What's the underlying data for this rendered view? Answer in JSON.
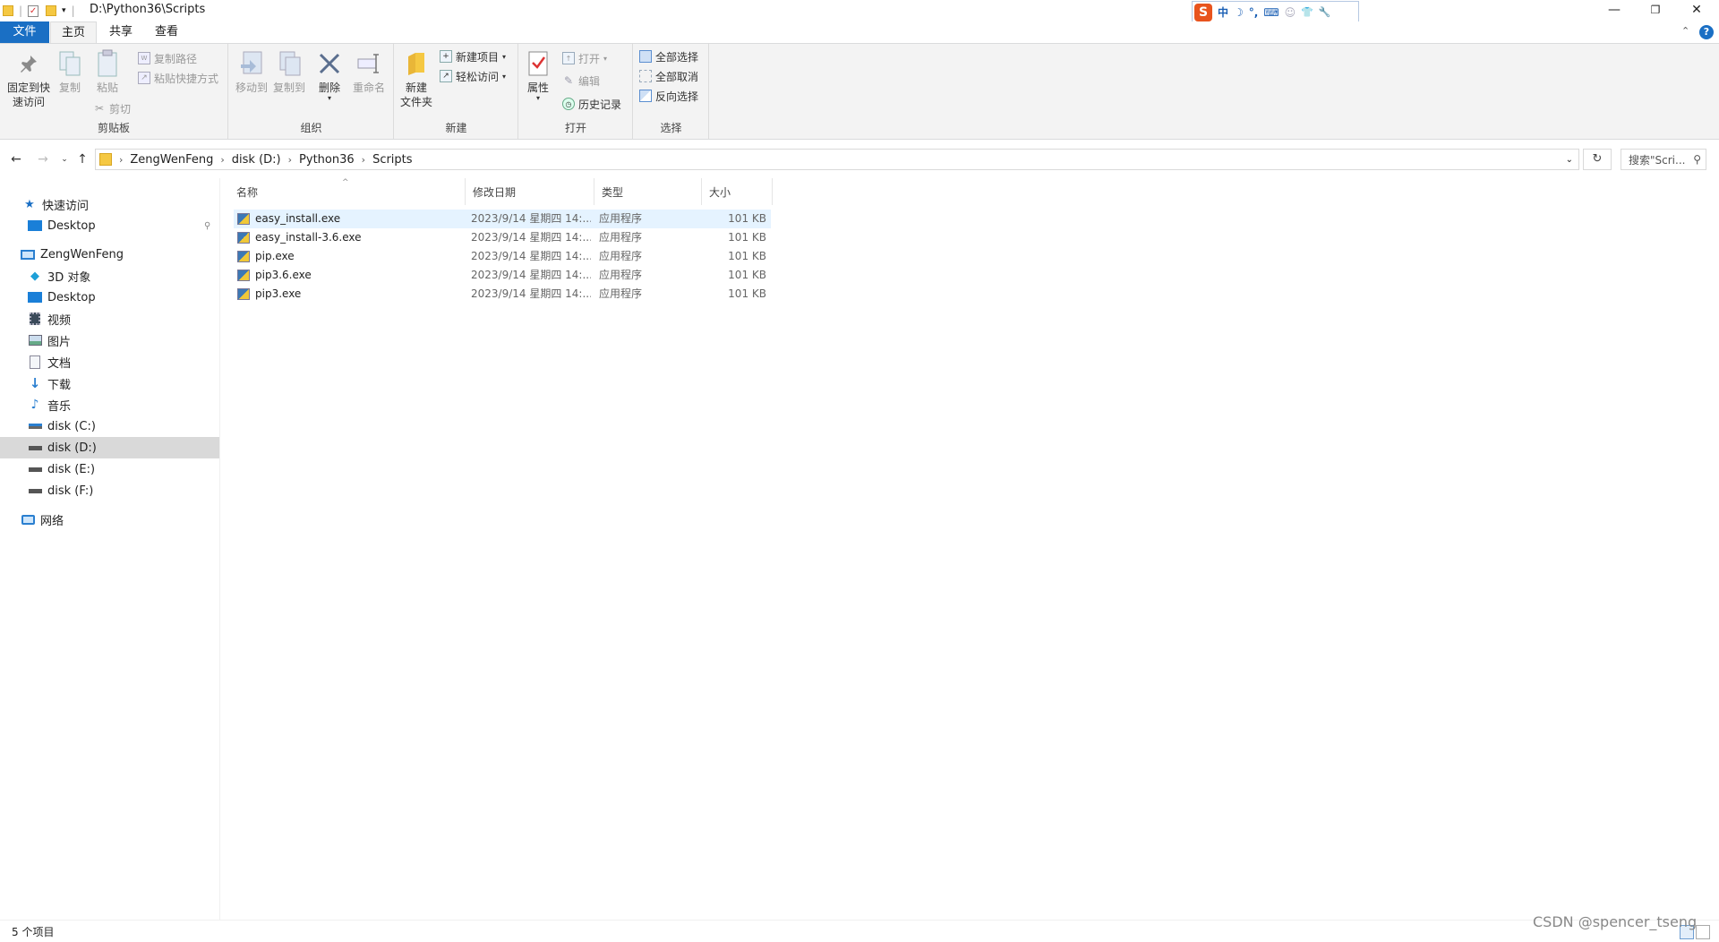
{
  "window": {
    "title": "D:\\Python36\\Scripts",
    "controls": {
      "minimize": "—",
      "restore": "❐",
      "close": "✕"
    }
  },
  "ime": {
    "logo": "S",
    "items": [
      "中",
      "☽",
      "°,",
      "⌨",
      "☺",
      "👕",
      "🔧"
    ]
  },
  "ribbon": {
    "tabs": {
      "file": "文件",
      "home": "主页",
      "share": "共享",
      "view": "查看"
    },
    "clipboard": {
      "pin_line1": "固定到快",
      "pin_line2": "速访问",
      "copy": "复制",
      "paste": "粘贴",
      "copy_path": "复制路径",
      "paste_shortcut": "粘贴快捷方式",
      "cut": "剪切",
      "label": "剪贴板"
    },
    "organize": {
      "move_to": "移动到",
      "copy_to": "复制到",
      "delete": "删除",
      "rename": "重命名",
      "label": "组织"
    },
    "new": {
      "new_folder_line1": "新建",
      "new_folder_line2": "文件夹",
      "new_item": "新建项目",
      "easy_access": "轻松访问",
      "label": "新建"
    },
    "open": {
      "properties": "属性",
      "open": "打开",
      "edit": "编辑",
      "history": "历史记录",
      "label": "打开"
    },
    "select": {
      "select_all": "全部选择",
      "select_none": "全部取消",
      "invert": "反向选择",
      "label": "选择"
    }
  },
  "address": {
    "crumbs": [
      "ZengWenFeng",
      "disk (D:)",
      "Python36",
      "Scripts"
    ],
    "search_placeholder": "搜索\"Scri..."
  },
  "navpane": {
    "quick_access": "快速访问",
    "qa_desktop": "Desktop",
    "this_pc": "ZengWenFeng",
    "items": [
      "3D 对象",
      "Desktop",
      "视频",
      "图片",
      "文档",
      "下载",
      "音乐",
      "disk (C:)",
      "disk (D:)",
      "disk (E:)",
      "disk (F:)"
    ],
    "network": "网络"
  },
  "columns": {
    "name": "名称",
    "modified": "修改日期",
    "type": "类型",
    "size": "大小"
  },
  "files": [
    {
      "name": "easy_install.exe",
      "modified": "2023/9/14 星期四 14:...",
      "type": "应用程序",
      "size": "101 KB"
    },
    {
      "name": "easy_install-3.6.exe",
      "modified": "2023/9/14 星期四 14:...",
      "type": "应用程序",
      "size": "101 KB"
    },
    {
      "name": "pip.exe",
      "modified": "2023/9/14 星期四 14:...",
      "type": "应用程序",
      "size": "101 KB"
    },
    {
      "name": "pip3.6.exe",
      "modified": "2023/9/14 星期四 14:...",
      "type": "应用程序",
      "size": "101 KB"
    },
    {
      "name": "pip3.exe",
      "modified": "2023/9/14 星期四 14:...",
      "type": "应用程序",
      "size": "101 KB"
    }
  ],
  "status": {
    "count": "5 个项目"
  },
  "watermark": "CSDN @spencer_tseng",
  "colors": {
    "accent": "#1a6fc4",
    "selected_row": "#e5f3ff",
    "nav_selected": "#d9d9d9",
    "folder": "#f5c842"
  }
}
